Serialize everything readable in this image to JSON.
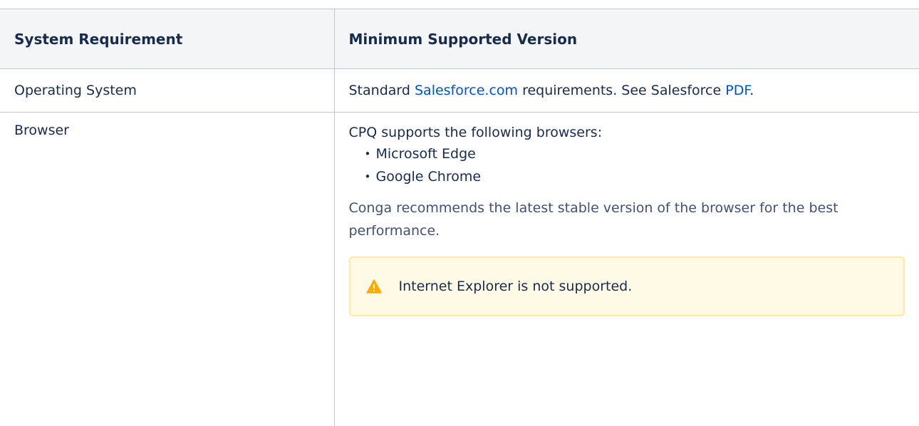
{
  "table": {
    "headers": [
      "System Requirement",
      "Minimum Supported Version"
    ],
    "rows": {
      "os": {
        "label": "Operating System",
        "text_before_link": "Standard ",
        "link1": "Salesforce.com",
        "text_middle": " requirements. See Salesforce ",
        "link2": "PDF",
        "text_after": "."
      },
      "browser": {
        "label": "Browser",
        "intro": "CPQ supports the following browsers:",
        "items": [
          "Microsoft Edge",
          "Google Chrome"
        ],
        "recommendation": "Conga recommends the latest stable version of the browser for the best performance.",
        "warning": "Internet Explorer is not supported."
      }
    }
  },
  "colors": {
    "link": "#0052cc",
    "header_bg": "#f4f5f7",
    "warning_bg": "#fffae6",
    "warning_border": "#ffe9a6",
    "warning_icon": "#ffab00"
  },
  "icons": {
    "warning": "warning-triangle-icon"
  }
}
